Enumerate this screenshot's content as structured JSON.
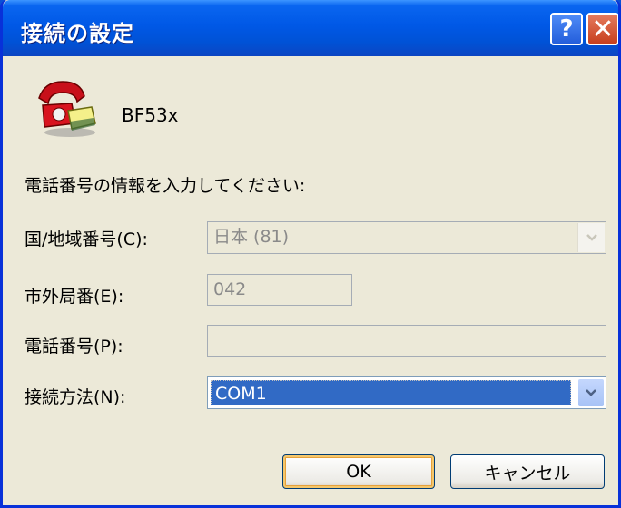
{
  "window": {
    "title": "接続の設定",
    "help_glyph": "?",
    "close_glyph": "✕"
  },
  "connection": {
    "name": "BF53x",
    "icon": "phone-icon"
  },
  "prompt": "電話番号の情報を入力してください:",
  "form": {
    "country": {
      "label": "国/地域番号(C):",
      "value": "日本 (81)",
      "enabled": false
    },
    "area": {
      "label": "市外局番(E):",
      "value": "042",
      "enabled": false
    },
    "phone": {
      "label": "電話番号(P):",
      "value": "",
      "enabled": false
    },
    "method": {
      "label": "接続方法(N):",
      "value": "COM1",
      "enabled": true
    }
  },
  "buttons": {
    "ok": "OK",
    "cancel": "キャンセル"
  },
  "colors": {
    "titlebar": "#0058e6",
    "face": "#ece9d8",
    "selection": "#316ac5"
  }
}
